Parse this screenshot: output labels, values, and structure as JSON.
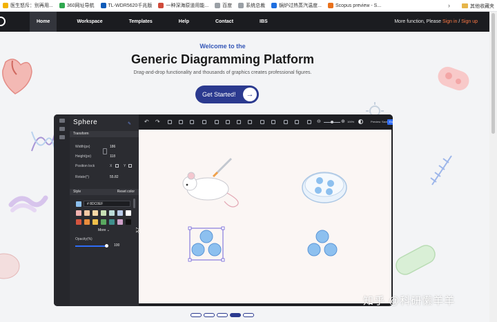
{
  "bookmarks": [
    {
      "label": "医生怒斥：别再用...",
      "color": "#f2b200"
    },
    {
      "label": "360网址导航",
      "color": "#2fa84f"
    },
    {
      "label": "TL-WDR5620千兆版",
      "color": "#0d5ab8"
    },
    {
      "label": "一种深海原道用能...",
      "color": "#d04a3a"
    },
    {
      "label": "百度",
      "color": "#9aa0a6"
    },
    {
      "label": "系统总裁",
      "color": "#9aa0a6"
    },
    {
      "label": "锅炉过热蒸汽温度...",
      "color": "#1f6fe0"
    },
    {
      "label": "Scopus preview - S...",
      "color": "#e9711c"
    }
  ],
  "bookmarks_folder": "其他收藏夹",
  "nav": {
    "items": [
      "Home",
      "Workspace",
      "Templates",
      "Help",
      "Contact",
      "IBS"
    ],
    "right_text": "More function, Please ",
    "sign_in": "Sign in",
    "separator": " / ",
    "sign_up": "Sign up"
  },
  "hero": {
    "welcome": "Welcome to the",
    "title": "Generic Diagramming Platform",
    "subtitle": "Drag-and-drop functionality and thousands of graphics creates professional figures.",
    "cta": "Get Started!"
  },
  "editor": {
    "brand": "Sphere",
    "transform_label": "Transform",
    "width_label": "Width(px)",
    "width_value": "186",
    "height_label": "Height(px)",
    "height_value": "118",
    "position_lock_label": "Position lock",
    "rotate_label": "Rotate(°)",
    "rotate_value": "55.82",
    "style_label": "Style",
    "reset_color_label": "Reset color",
    "hex_value": "# 8DC0EF",
    "more_label": "More",
    "opacity_label": "Opacity(%)",
    "opacity_value": "100",
    "zoom_value": "100%",
    "preview_label": "Preview",
    "save_label": "Save",
    "export_label": "Export",
    "swatches": [
      "#f2b3b1",
      "#f5c9a4",
      "#f7d8a7",
      "#c7e0b5",
      "#bcdcd9",
      "#b9cbe9",
      "#ffffff",
      "#d4543f",
      "#e88d3c",
      "#f1c04b",
      "#5aa960",
      "#3f8f8c",
      "#cfa1c9",
      "#111111"
    ],
    "accent": "#2f6cf5"
  },
  "pager": {
    "count": 5,
    "active": 3
  },
  "watermark": "知乎 @科研懒羊羊"
}
